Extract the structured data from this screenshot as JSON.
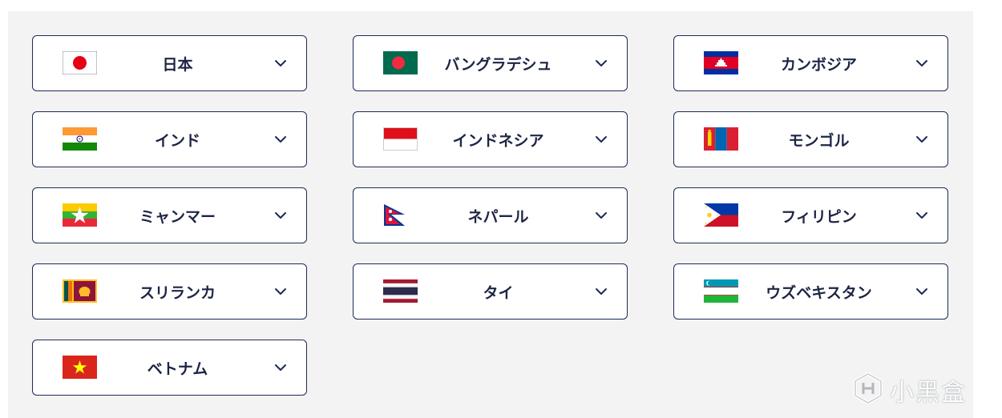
{
  "countries": [
    {
      "name": "日本",
      "flag": "japan-flag-icon"
    },
    {
      "name": "バングラデシュ",
      "flag": "bangladesh-flag-icon"
    },
    {
      "name": "カンボジア",
      "flag": "cambodia-flag-icon"
    },
    {
      "name": "インド",
      "flag": "india-flag-icon"
    },
    {
      "name": "インドネシア",
      "flag": "indonesia-flag-icon"
    },
    {
      "name": "モンゴル",
      "flag": "mongolia-flag-icon"
    },
    {
      "name": "ミャンマー",
      "flag": "myanmar-flag-icon"
    },
    {
      "name": "ネパール",
      "flag": "nepal-flag-icon"
    },
    {
      "name": "フィリピン",
      "flag": "philippines-flag-icon"
    },
    {
      "name": "スリランカ",
      "flag": "sri-lanka-flag-icon"
    },
    {
      "name": "タイ",
      "flag": "thailand-flag-icon"
    },
    {
      "name": "ウズベキスタン",
      "flag": "uzbekistan-flag-icon"
    },
    {
      "name": "ベトナム",
      "flag": "vietnam-flag-icon"
    }
  ],
  "watermark": {
    "text": "小黑盒",
    "icon": "xiaoheihe-logo-icon"
  },
  "colors": {
    "border": "#1d2a57",
    "text": "#1d2544",
    "panel": "#f3f3f3"
  }
}
